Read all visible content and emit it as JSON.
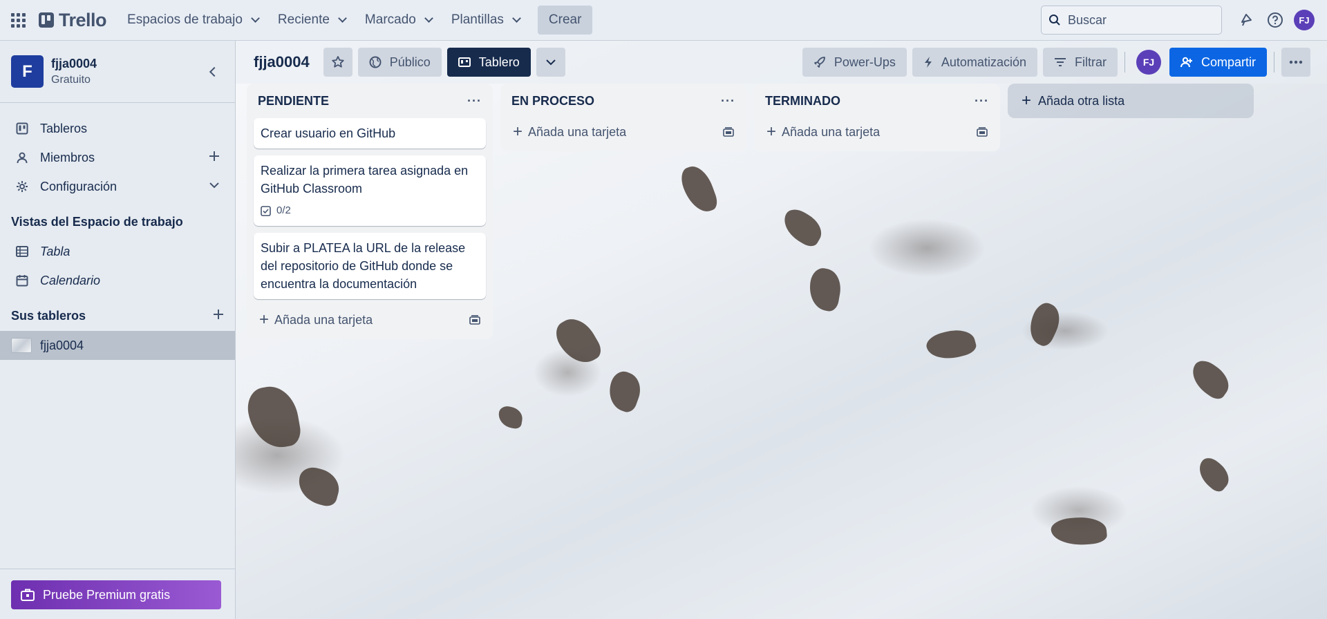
{
  "topnav": {
    "logo_text": "Trello",
    "menus": [
      "Espacios de trabajo",
      "Reciente",
      "Marcado",
      "Plantillas"
    ],
    "create_label": "Crear",
    "search_placeholder": "Buscar",
    "user_initials": "FJ"
  },
  "sidebar": {
    "workspace_initial": "F",
    "workspace_name": "fjja0004",
    "workspace_plan": "Gratuito",
    "nav": [
      {
        "label": "Tableros",
        "icon": "board-icon"
      },
      {
        "label": "Miembros",
        "icon": "person-icon"
      },
      {
        "label": "Configuración",
        "icon": "gear-icon"
      }
    ],
    "views_title": "Vistas del Espacio de trabajo",
    "views": [
      {
        "label": "Tabla",
        "icon": "table-icon"
      },
      {
        "label": "Calendario",
        "icon": "calendar-icon"
      }
    ],
    "boards_title": "Sus tableros",
    "boards": [
      {
        "label": "fjja0004"
      }
    ],
    "premium_label": "Pruebe Premium gratis"
  },
  "board": {
    "title": "fjja0004",
    "visibility_label": "Público",
    "view_label": "Tablero",
    "powerups_label": "Power-Ups",
    "automation_label": "Automatización",
    "filter_label": "Filtrar",
    "member_initials": "FJ",
    "share_label": "Compartir",
    "lists": [
      {
        "title": "PENDIENTE",
        "cards": [
          {
            "title": "Crear usuario en GitHub"
          },
          {
            "title": "Realizar la primera tarea asignada en GitHub Classroom",
            "checklist": "0/2"
          },
          {
            "title": "Subir a PLATEA la URL de la release del repositorio de GitHub donde se encuentra la documentación"
          }
        ],
        "add_card_label": "Añada una tarjeta"
      },
      {
        "title": "EN PROCESO",
        "cards": [],
        "add_card_label": "Añada una tarjeta"
      },
      {
        "title": "TERMINADO",
        "cards": [],
        "add_card_label": "Añada una tarjeta"
      }
    ],
    "add_list_label": "Añada otra lista"
  },
  "colors": {
    "accent": "#0c66e4",
    "workspace_badge": "#1f3d9e",
    "avatar": "#5b3fb8",
    "premium_start": "#6e2fb0",
    "premium_end": "#9a5ad3",
    "dark_button": "#172b4d"
  }
}
